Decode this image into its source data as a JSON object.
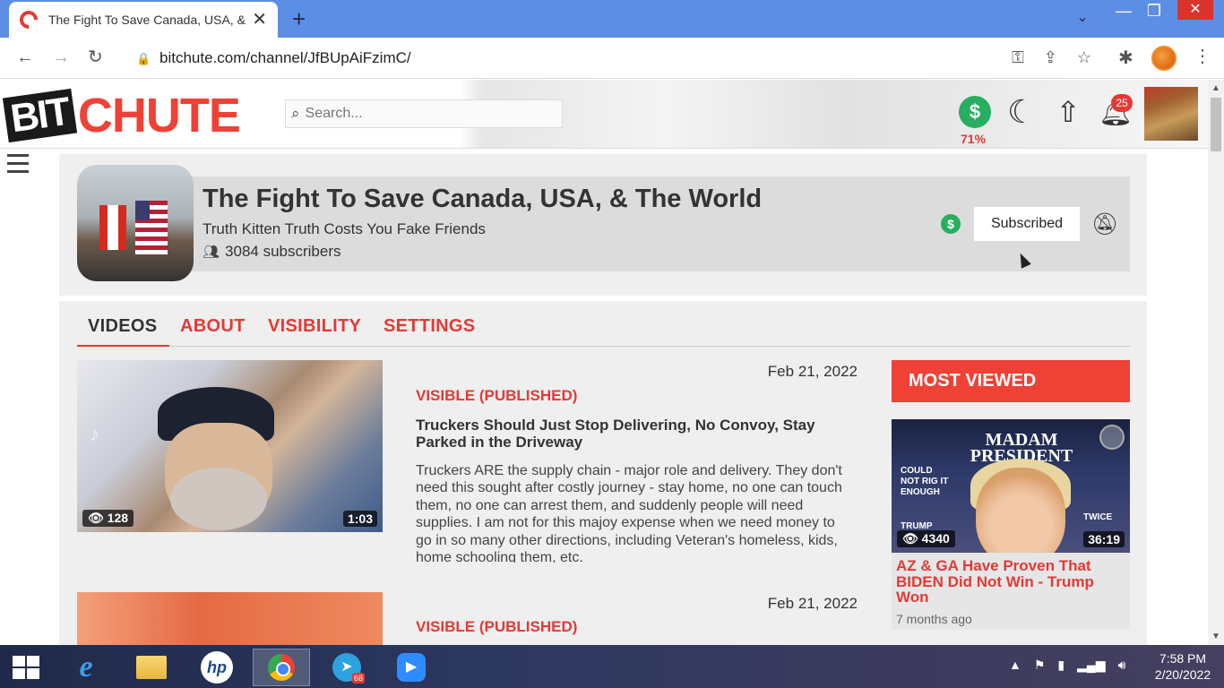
{
  "browser": {
    "tab_title": "The Fight To Save Canada, USA, & The World",
    "tab_close": "✕",
    "new_tab": "+",
    "url": "bitchute.com/channel/JfBUpAiFzimC/"
  },
  "site": {
    "logo_bit": "BIT",
    "logo_chute": "CHUTE",
    "search_placeholder": "Search...",
    "wallet_percent": "71%",
    "notification_count": "25"
  },
  "channel": {
    "title": "The Fight To Save Canada, USA, & The World",
    "tagline": "Truth Kitten Truth Costs You Fake Friends",
    "subscribers": "3084 subscribers",
    "subscribe_label": "Subscribed",
    "tabs": [
      {
        "label": "VIDEOS"
      },
      {
        "label": "ABOUT"
      },
      {
        "label": "VISIBILITY"
      },
      {
        "label": "SETTINGS"
      }
    ]
  },
  "videos": [
    {
      "date": "Feb 21, 2022",
      "status": "VISIBLE (PUBLISHED)",
      "title": "Truckers Should Just Stop Delivering, No Convoy, Stay Parked in the Driveway",
      "description": "Truckers ARE the supply chain - major role and delivery. They don't need this sought after costly journey - stay home, no one can touch them, no one can arrest them, and suddenly people will need supplies. I am not for this majoy expense when we need money to go in so many other directions, including Veteran's homeless, kids, home schooling them, etc.",
      "views": "128",
      "duration": "1:03"
    },
    {
      "date": "Feb 21, 2022",
      "status": "VISIBLE (PUBLISHED)"
    }
  ],
  "most_viewed": {
    "header": "MOST VIEWED",
    "magazine_title": "MADAM PRESIDENT",
    "thumb_text_left": "COULD NOT RIG IT ENOUGH",
    "thumb_text_trump": "TRUMP",
    "thumb_text_twice": "TWICE",
    "views": "4340",
    "duration": "36:19",
    "title": "AZ & GA Have Proven That BIDEN Did Not Win - Trump Won",
    "ago": "7 months ago"
  },
  "taskbar": {
    "telegram_badge": "68",
    "time": "7:58 PM",
    "date": "2/20/2022"
  },
  "colors": {
    "brand_red": "#ef4136",
    "accent_green": "#27ae60",
    "browser_blue": "#5d8ee6"
  }
}
